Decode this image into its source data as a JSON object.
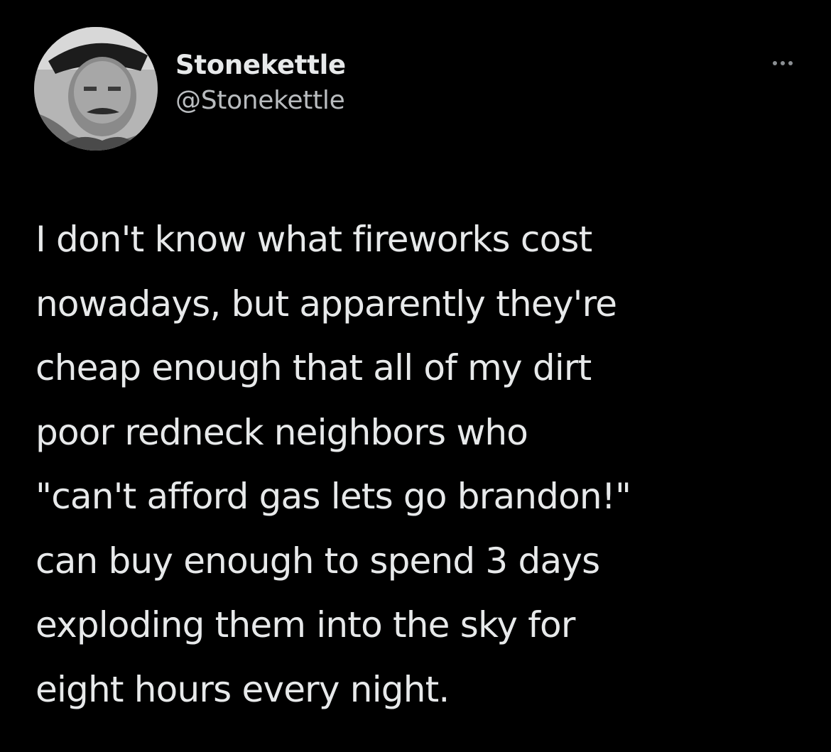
{
  "tweet": {
    "author": {
      "display_name": "Stonekettle",
      "handle": "@Stonekettle"
    },
    "text_lines": [
      "I don't know what fireworks cost",
      "nowadays, but apparently they're",
      "cheap enough that all of my dirt",
      "poor redneck neighbors who",
      "\"can't afford gas lets go brandon!\"",
      "can buy enough to spend 3 days",
      "exploding them into the sky for",
      "eight hours every night."
    ],
    "more_menu_icon": "more-horizontal-icon",
    "avatar_icon": "profile-photo"
  },
  "colors": {
    "background": "#000000",
    "text_primary": "#e7e9ea",
    "text_secondary": "#b9bcbf"
  }
}
